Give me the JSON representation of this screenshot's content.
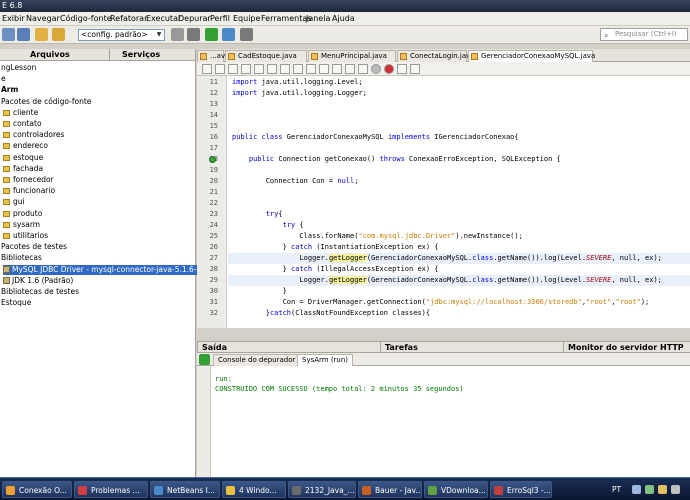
{
  "window": {
    "title": "E 6.8"
  },
  "menu": [
    "Exibir",
    "Navegar",
    "Código-fonte",
    "Refatorar",
    "Executar",
    "Depurar",
    "Perfil",
    "Equipe",
    "Ferramentas",
    "Janela",
    "Ajuda"
  ],
  "toolbar": {
    "config_value": "<config. padrão>",
    "search_placeholder": "Pesquisar (Ctrl+I)"
  },
  "left_tabs": [
    "Arquivos",
    "Serviços"
  ],
  "tree": [
    {
      "label": "ngLesson",
      "indent": 0,
      "icon": "none"
    },
    {
      "label": "e",
      "indent": 0,
      "icon": "none"
    },
    {
      "label": "Arm",
      "indent": 0,
      "icon": "none",
      "bold": true
    },
    {
      "label": "Pacotes de código-fonte",
      "indent": 0,
      "icon": "none"
    },
    {
      "label": "cliente",
      "indent": 1,
      "icon": "package"
    },
    {
      "label": "contato",
      "indent": 1,
      "icon": "package"
    },
    {
      "label": "controladores",
      "indent": 1,
      "icon": "package"
    },
    {
      "label": "endereco",
      "indent": 1,
      "icon": "package"
    },
    {
      "label": "estoque",
      "indent": 1,
      "icon": "package"
    },
    {
      "label": "fachada",
      "indent": 1,
      "icon": "package"
    },
    {
      "label": "fornecedor",
      "indent": 1,
      "icon": "package"
    },
    {
      "label": "funcionario",
      "indent": 1,
      "icon": "package"
    },
    {
      "label": "gui",
      "indent": 1,
      "icon": "package"
    },
    {
      "label": "produto",
      "indent": 1,
      "icon": "package"
    },
    {
      "label": "sysarm",
      "indent": 1,
      "icon": "package"
    },
    {
      "label": "utilitarios",
      "indent": 1,
      "icon": "package"
    },
    {
      "label": "Pacotes de testes",
      "indent": 0,
      "icon": "none"
    },
    {
      "label": "Bibliotecas",
      "indent": 0,
      "icon": "none"
    },
    {
      "label": "MySQL JDBC Driver - mysql-connector-java-5.1.6-bin.jar",
      "indent": 1,
      "icon": "jar",
      "selected": true
    },
    {
      "label": "JDK 1.6 (Padrão)",
      "indent": 1,
      "icon": "jar"
    },
    {
      "label": "Bibliotecas de testes",
      "indent": 0,
      "icon": "none"
    },
    {
      "label": "Estoque",
      "indent": 0,
      "icon": "none"
    }
  ],
  "doc_tabs": [
    {
      "label": "...ava",
      "active": false
    },
    {
      "label": "CadEstoque.java",
      "active": false
    },
    {
      "label": "MenuPrincipal.java",
      "active": false
    },
    {
      "label": "ConectaLogin.java",
      "active": false
    },
    {
      "label": "GerenciadorConexaoMySQL.java",
      "active": true
    }
  ],
  "line_numbers": [
    "11",
    "12",
    "13",
    "14",
    "15",
    "16",
    "17",
    "18",
    "19",
    "20",
    "21",
    "22",
    "23",
    "24",
    "25",
    "26",
    "27",
    "28",
    "29",
    "30",
    "31",
    "32"
  ],
  "code": [
    [
      {
        "t": "import",
        "c": "kw"
      },
      {
        "t": " java.util.logging.Level;"
      }
    ],
    [
      {
        "t": "import",
        "c": "kw"
      },
      {
        "t": " java.util.logging.Logger;"
      }
    ],
    [],
    [],
    [],
    [
      {
        "t": "public class",
        "c": "kw"
      },
      {
        "t": " GerenciadorConexaoMySQL "
      },
      {
        "t": "implements",
        "c": "kw"
      },
      {
        "t": " IGerenciadorConexao{"
      }
    ],
    [],
    [
      {
        "t": "    "
      },
      {
        "t": "public",
        "c": "kw"
      },
      {
        "t": " Connection getConexao() "
      },
      {
        "t": "throws",
        "c": "kw"
      },
      {
        "t": " ConexaoErroException, SQLException {"
      }
    ],
    [],
    [
      {
        "t": "        Connection Con = "
      },
      {
        "t": "null",
        "c": "kw"
      },
      {
        "t": ";"
      }
    ],
    [],
    [],
    [
      {
        "t": "        "
      },
      {
        "t": "try",
        "c": "kw"
      },
      {
        "t": "{"
      }
    ],
    [
      {
        "t": "            "
      },
      {
        "t": "try",
        "c": "kw"
      },
      {
        "t": " {"
      }
    ],
    [
      {
        "t": "                Class.forName("
      },
      {
        "t": "\"com.mysql.jdbc.Driver\"",
        "c": "str"
      },
      {
        "t": ").newInstance();"
      }
    ],
    [
      {
        "t": "            } "
      },
      {
        "t": "catch",
        "c": "kw"
      },
      {
        "t": " (InstantiationException ex) {"
      }
    ],
    [
      {
        "t": "                Logger."
      },
      {
        "t": "getLogger",
        "c": "mk"
      },
      {
        "t": "(GerenciadorConexaoMySQL."
      },
      {
        "t": "class",
        "c": "kw"
      },
      {
        "t": ".getName()).log(Level."
      },
      {
        "t": "SEVERE",
        "c": "it"
      },
      {
        "t": ", null, ex);"
      }
    ],
    [
      {
        "t": "            } "
      },
      {
        "t": "catch",
        "c": "kw"
      },
      {
        "t": " (IllegalAccessException ex) {"
      }
    ],
    [
      {
        "t": "                Logger."
      },
      {
        "t": "getLogger",
        "c": "mk"
      },
      {
        "t": "(GerenciadorConexaoMySQL."
      },
      {
        "t": "class",
        "c": "kw"
      },
      {
        "t": ".getName()).log(Level."
      },
      {
        "t": "SEVERE",
        "c": "it"
      },
      {
        "t": ", null, ex);"
      }
    ],
    [
      {
        "t": "            }"
      }
    ],
    [
      {
        "t": "            Con = DriverManager.getConnection("
      },
      {
        "t": "\"jdbc:mysql://localhost:3306/storedb\"",
        "c": "str"
      },
      {
        "t": ","
      },
      {
        "t": "\"root\"",
        "c": "str"
      },
      {
        "t": ","
      },
      {
        "t": "\"root\"",
        "c": "str"
      },
      {
        "t": ");"
      }
    ],
    [
      {
        "t": "        }"
      },
      {
        "t": "catch",
        "c": "kw"
      },
      {
        "t": "(ClassNotFoundException classes){"
      }
    ]
  ],
  "bottom_tabs": [
    "Saída",
    "Tarefas",
    "Monitor do servidor HTTP"
  ],
  "output_tabs": [
    {
      "label": "Console do depurador",
      "active": false
    },
    {
      "label": "SysArm (run)",
      "active": true
    }
  ],
  "output": [
    "run:",
    "CONSTRUÍDO COM SUCESSO (tempo total: 2 minutos 35 segundos)"
  ],
  "taskbar": [
    "Conexão O...",
    "Problemas ...",
    "NetBeans I...",
    "4 Windo...",
    "2132_Java_...",
    "Bauer - Jav...",
    "VDownloa...",
    "ErroSql3 -..."
  ],
  "tray": {
    "lang": "PT"
  }
}
